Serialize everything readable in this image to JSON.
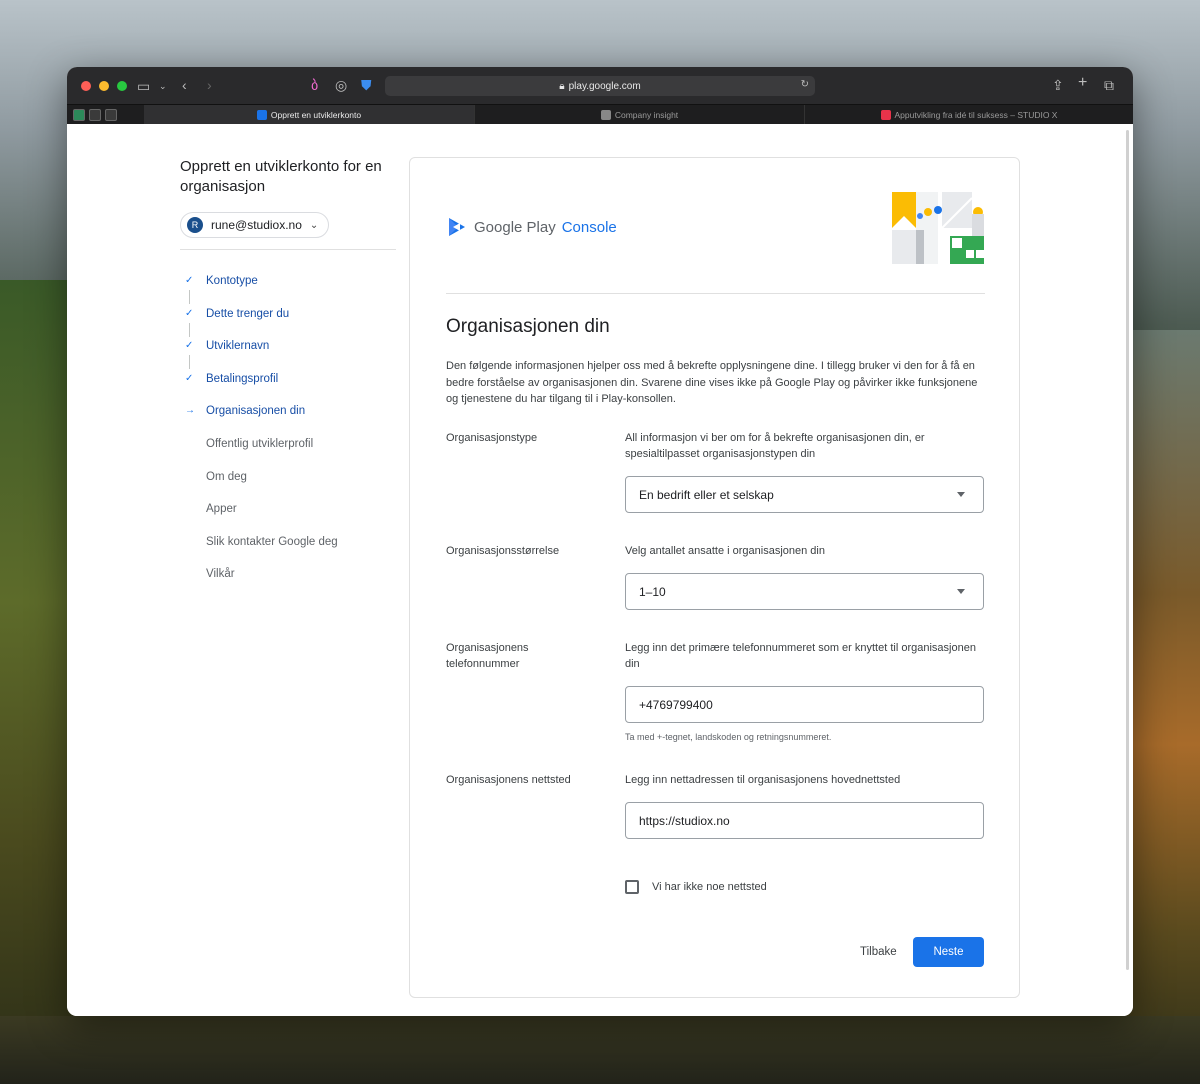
{
  "browser": {
    "url": "play.google.com",
    "tabs": [
      {
        "title": "Opprett en utviklerkonto",
        "active": true
      },
      {
        "title": "Company insight",
        "active": false
      },
      {
        "title": "Apputvikling fra idé til suksess – STUDIO X",
        "active": false
      }
    ]
  },
  "sidebar": {
    "title": "Opprett en utviklerkonto for en organisasjon",
    "account": {
      "initial": "R",
      "email": "rune@studiox.no"
    },
    "steps": [
      {
        "label": "Kontotype",
        "state": "done"
      },
      {
        "label": "Dette trenger du",
        "state": "done"
      },
      {
        "label": "Utviklernavn",
        "state": "done"
      },
      {
        "label": "Betalingsprofil",
        "state": "done"
      },
      {
        "label": "Organisasjonen din",
        "state": "current"
      },
      {
        "label": "Offentlig utviklerprofil",
        "state": "todo"
      },
      {
        "label": "Om deg",
        "state": "todo"
      },
      {
        "label": "Apper",
        "state": "todo"
      },
      {
        "label": "Slik kontakter Google deg",
        "state": "todo"
      },
      {
        "label": "Vilkår",
        "state": "todo"
      }
    ]
  },
  "brand": {
    "google": "Google Play",
    "console": "Console"
  },
  "main": {
    "heading": "Organisasjonen din",
    "intro": "Den følgende informasjonen hjelper oss med å bekrefte opplysningene dine. I tillegg bruker vi den for å få en bedre forståelse av organisasjonen din. Svarene dine vises ikke på Google Play og påvirker ikke funksjonene og tjenestene du har tilgang til i Play-konsollen.",
    "org_type": {
      "label": "Organisasjonstype",
      "desc": "All informasjon vi ber om for å bekrefte organisasjonen din, er spesialtilpasset organisasjonstypen din",
      "value": "En bedrift eller et selskap"
    },
    "org_size": {
      "label": "Organisasjonsstørrelse",
      "desc": "Velg antallet ansatte i organisasjonen din",
      "value": "1–10"
    },
    "phone": {
      "label": "Organisasjonens telefonnummer",
      "desc": "Legg inn det primære telefonnummeret som er knyttet til organisasjonen din",
      "value": "+4769799400",
      "hint": "Ta med +-tegnet, landskoden og retningsnummeret."
    },
    "website": {
      "label": "Organisasjonens nettsted",
      "desc": "Legg inn nettadressen til organisasjonens hovednettsted",
      "value": "https://studiox.no"
    },
    "no_website_label": "Vi har ikke noe nettsted",
    "back_label": "Tilbake",
    "next_label": "Neste"
  },
  "colors": {
    "accent": "#1a73e8",
    "link": "#174ea6",
    "text": "#202124"
  }
}
